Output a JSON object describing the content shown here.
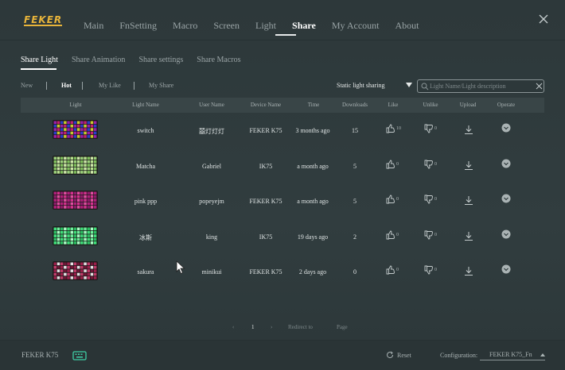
{
  "app": {
    "logo": "FEKER"
  },
  "nav": {
    "items": [
      {
        "label": "Main"
      },
      {
        "label": "FnSetting"
      },
      {
        "label": "Macro"
      },
      {
        "label": "Screen"
      },
      {
        "label": "Light"
      },
      {
        "label": "Share"
      },
      {
        "label": "My Account"
      },
      {
        "label": "About"
      }
    ],
    "active": "Share"
  },
  "subtabs": [
    {
      "label": "Share Light"
    },
    {
      "label": "Share Animation"
    },
    {
      "label": "Share settings"
    },
    {
      "label": "Share Macros"
    }
  ],
  "filters": {
    "new": "New",
    "hot": "Hot",
    "my_like": "My Like",
    "my_share": "My Share",
    "active": "Hot"
  },
  "sharing_select": {
    "value": "Static light sharing"
  },
  "search": {
    "placeholder": "Light Name/Light description",
    "value": ""
  },
  "table": {
    "headers": {
      "light": "Light",
      "light_name": "Light Name",
      "user_name": "User Name",
      "device_name": "Device Name",
      "time": "Time",
      "downloads": "Downloads",
      "like": "Like",
      "unlike": "Unlike",
      "upload": "Upload",
      "operate": "Operate"
    },
    "rows": [
      {
        "light_name": "switch",
        "user_name": "囍灯灯灯",
        "device_name": "FEKER K75",
        "time": "3 months ago",
        "downloads": "15",
        "likes": "10",
        "unlikes": "0",
        "preview_colors": [
          "#9a1ea8",
          "#c1216e",
          "#2a3ec9",
          "#c9c92a"
        ]
      },
      {
        "light_name": "Matcha",
        "user_name": "Gabriel",
        "device_name": "IK75",
        "time": "a month ago",
        "downloads": "5",
        "likes": "0",
        "unlikes": "0",
        "preview_colors": [
          "#9ad07a",
          "#b6e08e",
          "#7fbf5c",
          "#cde8a8"
        ]
      },
      {
        "light_name": "pink ppp",
        "user_name": "popeyejm",
        "device_name": "FEKER K75",
        "time": "a month ago",
        "downloads": "5",
        "likes": "0",
        "unlikes": "0",
        "preview_colors": [
          "#b01e7a",
          "#d4308e",
          "#8e1a6a",
          "#e04da0"
        ]
      },
      {
        "light_name": "冰斯",
        "user_name": "king",
        "device_name": "IK75",
        "time": "19 days ago",
        "downloads": "2",
        "likes": "0",
        "unlikes": "0",
        "preview_colors": [
          "#3fe07a",
          "#6cf09a",
          "#2bbf62",
          "#a8ffc4"
        ]
      },
      {
        "light_name": "sakura",
        "user_name": "minikui",
        "device_name": "FEKER K75",
        "time": "2 days ago",
        "downloads": "0",
        "likes": "0",
        "unlikes": "0",
        "preview_colors": [
          "#9c1e4a",
          "#e6e0e4",
          "#c23a6a",
          "#6e1636"
        ]
      }
    ]
  },
  "pagination": {
    "prev": "‹",
    "current_page": "1",
    "next": "›",
    "redirect_label": "Redirect to",
    "page_label": "Page"
  },
  "footer": {
    "device": "FEKER K75",
    "reset": "Reset",
    "config_label": "Configuration:",
    "config_value": "FEKER K75_Fn"
  },
  "colors": {
    "background": "#2f3a3c",
    "header_row": "#394547",
    "logo": "#e8b43a",
    "keyboard_icon": "#3ecfa6"
  }
}
